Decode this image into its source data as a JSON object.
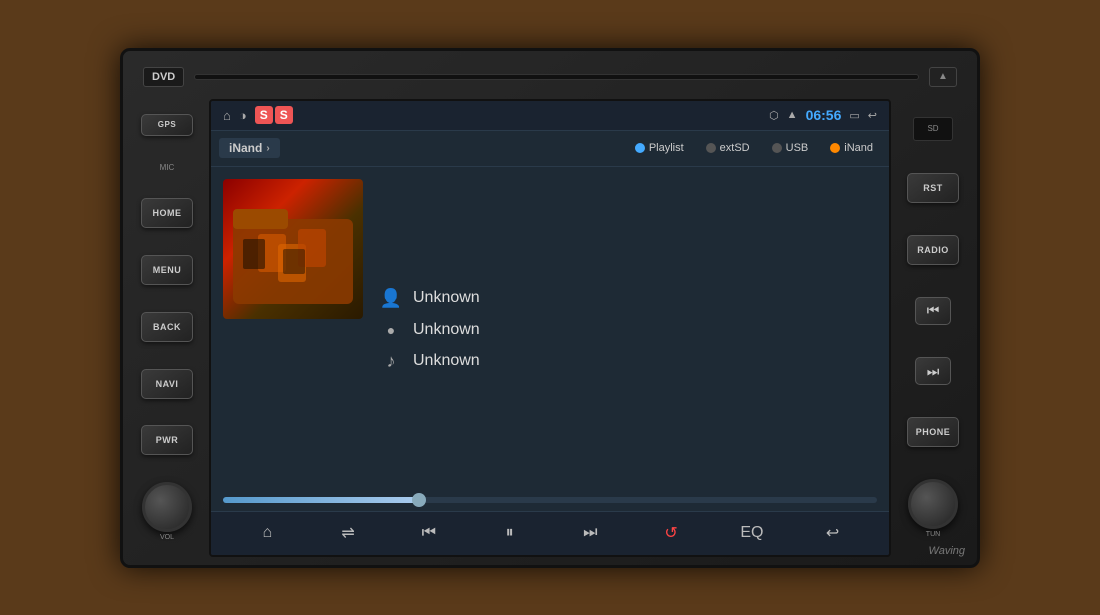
{
  "device": {
    "dvd_label": "DVD",
    "eject_symbol": "▲",
    "sd_label": "SD"
  },
  "left_buttons": [
    {
      "label": "GPS",
      "name": "gps"
    },
    {
      "label": "MIC",
      "name": "mic"
    },
    {
      "label": "HOME",
      "name": "home"
    },
    {
      "label": "MENU",
      "name": "menu"
    },
    {
      "label": "BACK",
      "name": "back"
    },
    {
      "label": "NAVI",
      "name": "navi"
    },
    {
      "label": "PWR",
      "name": "pwr"
    }
  ],
  "right_buttons": [
    {
      "label": "RST",
      "name": "rst"
    },
    {
      "label": "RADIO",
      "name": "radio"
    },
    {
      "label": "PHONE",
      "name": "phone"
    }
  ],
  "status_bar": {
    "home_icon": "⌂",
    "brightness_icon": "◑",
    "time": "06:56",
    "bluetooth_icon": "⬡",
    "wifi_icon": "▲",
    "battery_icon": "▭",
    "back_icon": "↩"
  },
  "source": {
    "label": "iNand",
    "arrow": "›"
  },
  "tabs": [
    {
      "label": "Playlist",
      "dot_color": "blue",
      "active": true
    },
    {
      "label": "extSD",
      "dot_color": "gray",
      "active": false
    },
    {
      "label": "USB",
      "dot_color": "gray",
      "active": false
    },
    {
      "label": "iNand",
      "dot_color": "orange",
      "active": false
    }
  ],
  "track_info": {
    "artist": "Unknown",
    "album": "Unknown",
    "title": "Unknown",
    "artist_icon": "👤",
    "album_icon": "●",
    "music_icon": "♪"
  },
  "controls": {
    "home": "⌂",
    "shuffle": "⇌",
    "prev": "⏮",
    "play_pause": "⏸",
    "next": "⏭",
    "loop": "↺",
    "eq": "EQ",
    "back": "↩"
  },
  "progress": {
    "fill_percent": 30
  },
  "watermark": "Waving"
}
